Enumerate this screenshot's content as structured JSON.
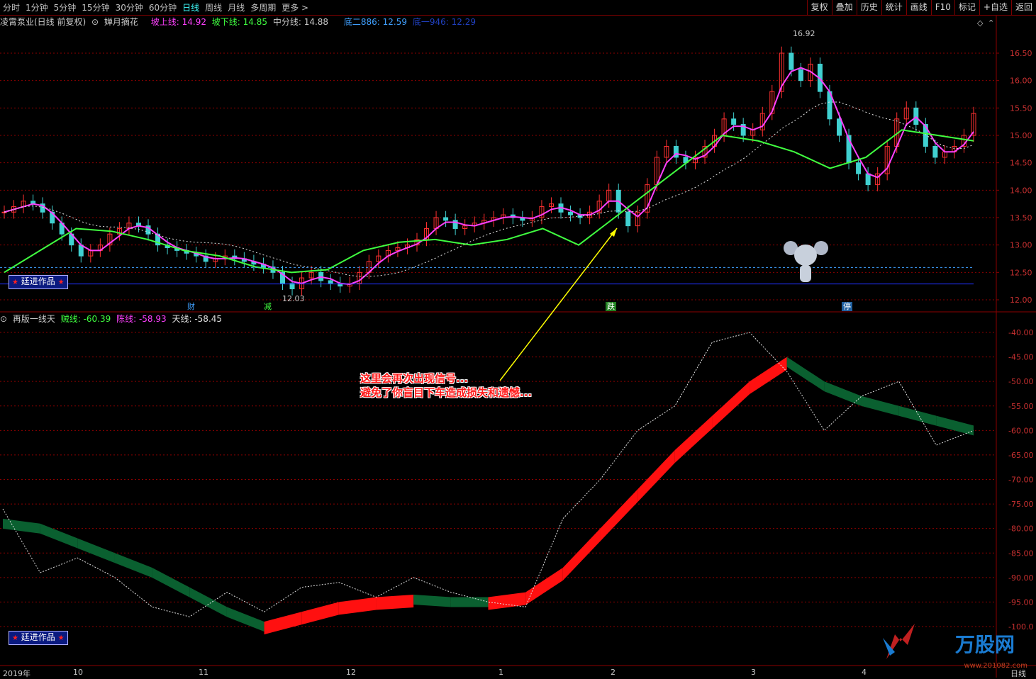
{
  "toolbar": {
    "periods": [
      "分时",
      "1分钟",
      "5分钟",
      "15分钟",
      "30分钟",
      "60分钟",
      "日线",
      "周线",
      "月线",
      "多周期",
      "更多 >"
    ],
    "active_period": "日线",
    "buttons": [
      "复权",
      "叠加",
      "历史",
      "统计",
      "画线",
      "F10",
      "标记",
      "+自选",
      "返回"
    ]
  },
  "main_info": {
    "stock": "凌霄泵业(日线 前复权)",
    "indicator": "婵月摘花",
    "up_line": "坡上线: 14.92",
    "down_line": "坡下线: 14.85",
    "mid_line": "中分线: 14.88",
    "d2": "底二886: 12.59",
    "d1": "底一946: 12.29"
  },
  "sub_info": {
    "indicator": "再版一线天",
    "l1": "贼线: -60.39",
    "l2": "陈线: -58.93",
    "l3": "天线: -58.45"
  },
  "badges": {
    "main": "廷进作品",
    "sub": "廷进作品"
  },
  "price_axis": [
    "16.50",
    "16.00",
    "15.50",
    "15.00",
    "14.50",
    "14.00",
    "13.50",
    "13.00",
    "12.50",
    "12.00"
  ],
  "sub_axis": [
    "-40.00",
    "-45.00",
    "-50.00",
    "-55.00",
    "-60.00",
    "-65.00",
    "-70.00",
    "-75.00",
    "-80.00",
    "-85.00",
    "-90.00",
    "-95.00",
    "-100.0"
  ],
  "high_label": "16.92",
  "low_label": "12.03",
  "events": [
    "财",
    "减",
    "跌",
    "停"
  ],
  "annotation": {
    "line1": "这里会再次出现信号...",
    "line2": "避免了你盲目下车造成损失和遗憾..."
  },
  "dates": [
    "2019年",
    "10",
    "11",
    "12",
    "1",
    "2",
    "3",
    "4"
  ],
  "bottom_period": "日线",
  "watermark": {
    "title": "万股网",
    "url": "www.201082.com"
  },
  "colors": {
    "up": "#ff3030",
    "down": "#40d0d0",
    "magenta": "#ff40ff",
    "green": "#40ff40",
    "grid": "#8b0000"
  },
  "chart_data": {
    "type": "candlestick",
    "main_close": [
      13.6,
      13.7,
      13.8,
      13.75,
      13.6,
      13.4,
      13.2,
      13.0,
      12.8,
      12.9,
      13.0,
      13.2,
      13.3,
      13.4,
      13.35,
      13.2,
      13.0,
      12.95,
      12.9,
      12.85,
      12.8,
      12.7,
      12.75,
      12.8,
      12.75,
      12.7,
      12.65,
      12.6,
      12.5,
      12.3,
      12.2,
      12.4,
      12.5,
      12.35,
      12.3,
      12.25,
      12.3,
      12.5,
      12.7,
      12.8,
      12.9,
      12.95,
      13.0,
      13.1,
      13.3,
      13.5,
      13.45,
      13.3,
      13.35,
      13.4,
      13.45,
      13.5,
      13.55,
      13.5,
      13.45,
      13.5,
      13.7,
      13.75,
      13.6,
      13.55,
      13.5,
      13.6,
      13.8,
      14.0,
      13.6,
      13.35,
      13.6,
      14.1,
      14.6,
      14.8,
      14.6,
      14.5,
      14.6,
      14.8,
      15.0,
      15.3,
      15.2,
      15.0,
      15.1,
      15.4,
      15.8,
      16.5,
      16.2,
      16.0,
      16.3,
      15.8,
      15.3,
      15.0,
      14.5,
      14.3,
      14.1,
      14.3,
      14.8,
      15.3,
      15.5,
      15.2,
      14.8,
      14.6,
      14.7,
      14.8,
      15.0,
      15.4
    ],
    "sub_series": {
      "red_green_band_top": [
        -78,
        -79,
        -82,
        -85,
        -88,
        -92,
        -96,
        -99,
        -97,
        -95,
        -94,
        -93.5,
        -94,
        -94,
        -93,
        -88,
        -80,
        -72,
        -64,
        -57,
        -50,
        -45,
        -50,
        -53,
        -55,
        -57,
        -59
      ],
      "white_dotted": [
        -76,
        -89,
        -86,
        -90,
        -96,
        -98,
        -93,
        -97,
        -92,
        -91,
        -94,
        -90,
        -93,
        -95,
        -96,
        -78,
        -70,
        -60,
        -55,
        -42,
        -40,
        -48,
        -60,
        -53,
        -50,
        -63,
        -60
      ]
    },
    "ylim_main": [
      11.9,
      17.0
    ],
    "ylim_sub": [
      -101,
      -38
    ]
  }
}
